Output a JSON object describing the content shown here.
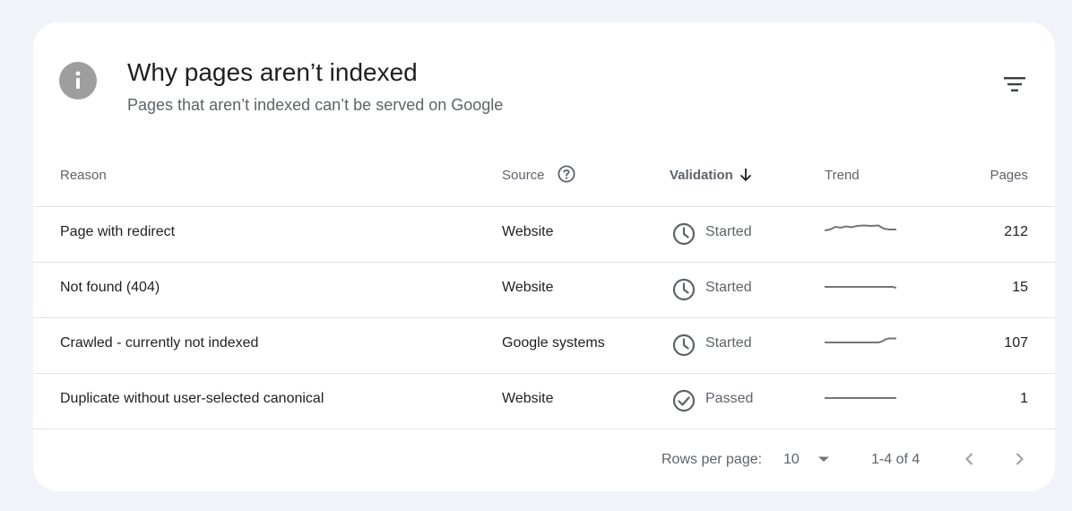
{
  "header": {
    "title": "Why pages aren’t indexed",
    "subtitle": "Pages that aren’t indexed can’t be served on Google"
  },
  "table": {
    "columns": {
      "reason": "Reason",
      "source": "Source",
      "validation": "Validation",
      "trend": "Trend",
      "pages": "Pages"
    },
    "rows": [
      {
        "reason": "Page with redirect",
        "source": "Website",
        "status": "Started",
        "status_icon": "clock-icon",
        "pages": "212"
      },
      {
        "reason": "Not found (404)",
        "source": "Website",
        "status": "Started",
        "status_icon": "clock-icon",
        "pages": "15"
      },
      {
        "reason": "Crawled - currently not indexed",
        "source": "Google systems",
        "status": "Started",
        "status_icon": "clock-icon",
        "pages": "107"
      },
      {
        "reason": "Duplicate without user-selected canonical",
        "source": "Website",
        "status": "Passed",
        "status_icon": "check-circle-icon",
        "pages": "1"
      }
    ]
  },
  "pagination": {
    "rows_per_page_label": "Rows per page:",
    "rows_per_page_value": "10",
    "range": "1-4 of 4"
  },
  "colors": {
    "background": "#f0f4f9",
    "card": "#ffffff",
    "icon_gray": "#9e9e9e",
    "text_secondary": "#5f6368"
  }
}
